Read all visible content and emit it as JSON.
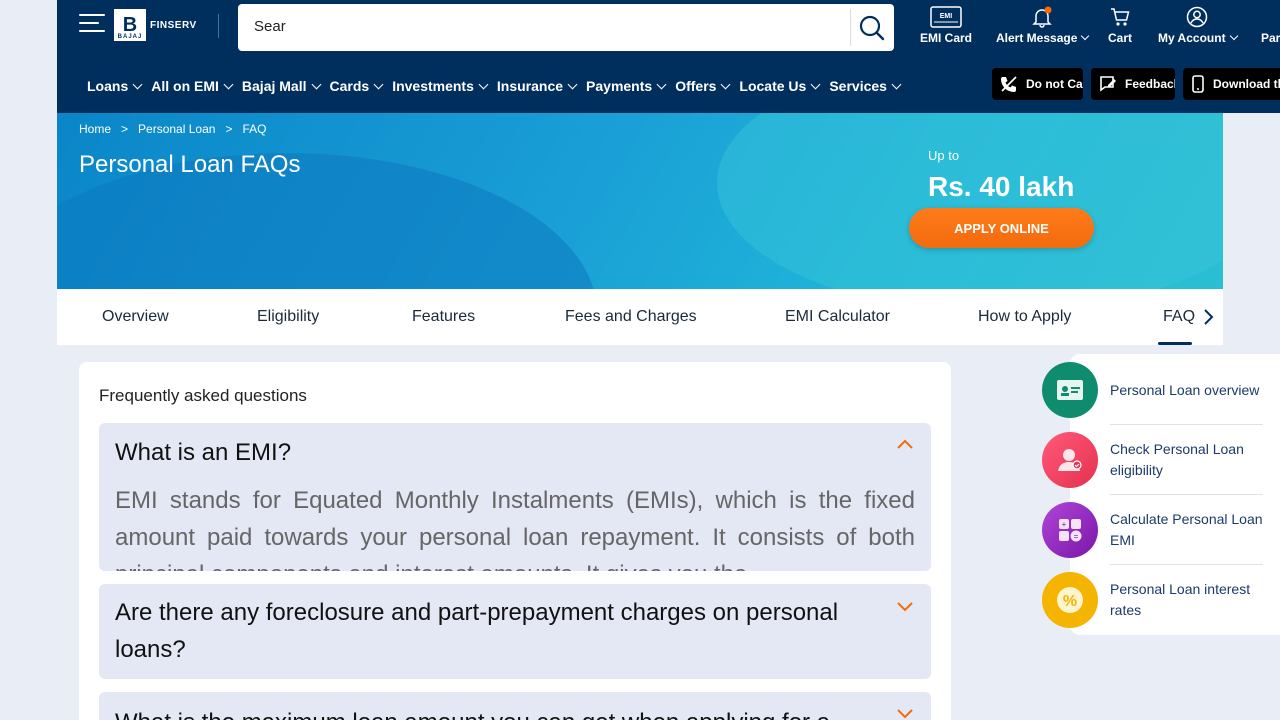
{
  "header": {
    "logo_text": "FINSERV",
    "logo_sub": "BAJAJ",
    "search_value": "Sear",
    "emi_card": "EMI Card",
    "alert_message": "Alert Message",
    "cart": "Cart",
    "my_account": "My Account",
    "partner": "Part",
    "emi_badge": "EMI"
  },
  "menu": [
    "Loans",
    "All on EMI",
    "Bajaj Mall",
    "Cards",
    "Investments",
    "Insurance",
    "Payments",
    "Offers",
    "Locate Us",
    "Services"
  ],
  "quick_buttons": {
    "do_not_call": "Do not Call",
    "feedback": "Feedback",
    "download": "Download th"
  },
  "breadcrumb": {
    "home": "Home",
    "personal_loan": "Personal Loan",
    "faq": "FAQ",
    "sep": ">"
  },
  "hero": {
    "title": "Personal Loan FAQs",
    "up_to": "Up to",
    "amount": "Rs. 40 lakh",
    "apply": "APPLY ONLINE"
  },
  "tabs": [
    "Overview",
    "Eligibility",
    "Features",
    "Fees and Charges",
    "EMI Calculator",
    "How to Apply",
    "FAQ"
  ],
  "faq": {
    "heading": "Frequently asked questions",
    "items": [
      {
        "question": "What is an EMI?",
        "answer": "EMI stands for Equated Monthly Instalments (EMIs), which is the fixed amount paid towards your personal loan repayment. It consists of both principal components and interest amounts. It gives you the"
      },
      {
        "question": "Are there any foreclosure and part-prepayment charges on personal loans?"
      },
      {
        "question": "What is the maximum loan amount you can get when applying for a"
      }
    ]
  },
  "side_links": [
    {
      "label": "Personal Loan overview",
      "icon": "id-card-icon",
      "color": "#0f8c6e"
    },
    {
      "label": "Check Personal Loan eligibility",
      "icon": "user-check-icon",
      "color": "#e5304f"
    },
    {
      "label": "Calculate Personal Loan EMI",
      "icon": "calculator-icon",
      "color": "#8b1fb8"
    },
    {
      "label": "Personal Loan interest rates",
      "icon": "percent-icon",
      "color": "#f5b400"
    }
  ],
  "colors": {
    "navy": "#002f5e",
    "orange": "#f26b0d",
    "accent_orange": "#ff6a00"
  }
}
